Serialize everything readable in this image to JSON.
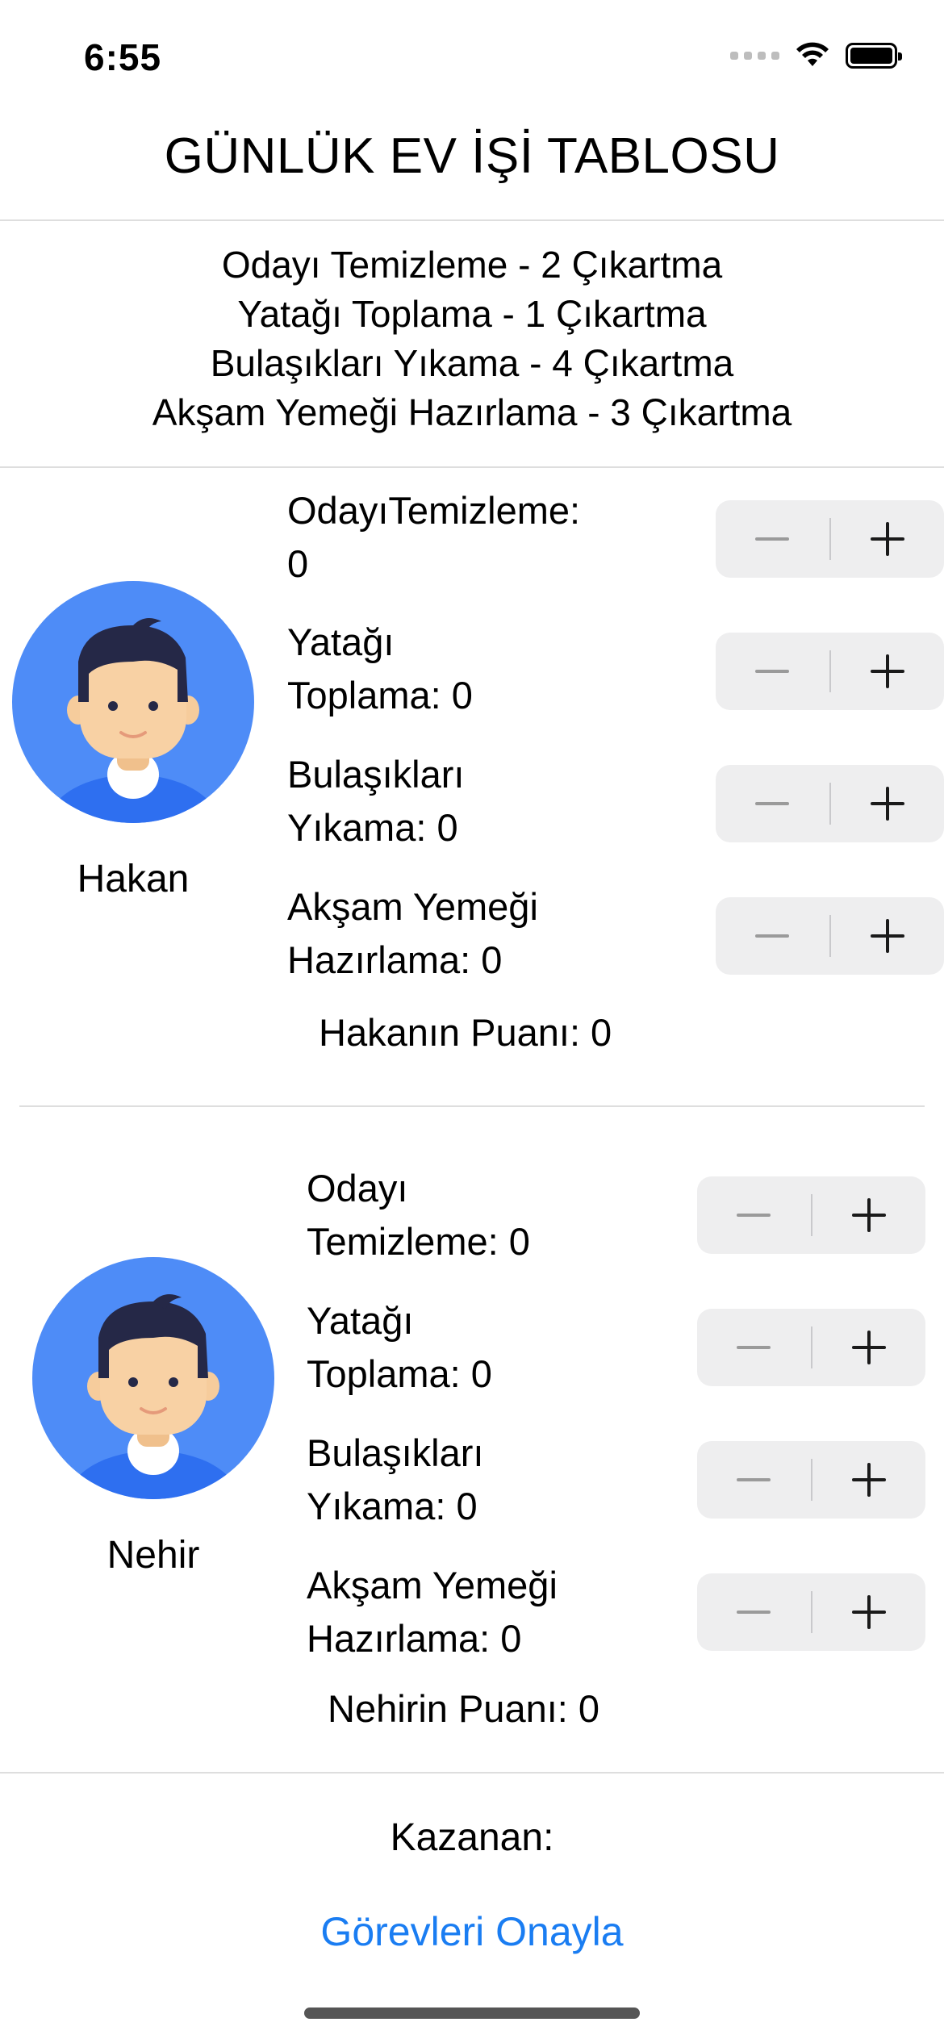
{
  "status_bar": {
    "time": "6:55"
  },
  "title": "GÜNLÜK EV İŞİ TABLOSU",
  "rules": [
    "Odayı Temizleme - 2 Çıkartma",
    "Yatağı Toplama - 1 Çıkartma",
    "Bulaşıkları Yıkama - 4 Çıkartma",
    "Akşam Yemeği Hazırlama - 3 Çıkartma"
  ],
  "players": [
    {
      "name": "Hakan",
      "tasks": [
        {
          "line1": "OdayıTemizleme:",
          "line2": "0"
        },
        {
          "line1": "Yatağı",
          "line2": "Toplama: 0"
        },
        {
          "line1": "Bulaşıkları",
          "line2": "Yıkama: 0"
        },
        {
          "line1": "Akşam Yemeği",
          "line2": "Hazırlama: 0"
        }
      ],
      "score": "Hakanın Puanı: 0"
    },
    {
      "name": "Nehir",
      "tasks": [
        {
          "line1": "Odayı",
          "line2": "Temizleme: 0"
        },
        {
          "line1": "Yatağı",
          "line2": "Toplama: 0"
        },
        {
          "line1": "Bulaşıkları",
          "line2": "Yıkama: 0"
        },
        {
          "line1": "Akşam Yemeği",
          "line2": "Hazırlama: 0"
        }
      ],
      "score": "Nehirin Puanı: 0"
    }
  ],
  "winner_label": "Kazanan:",
  "confirm_button": "Görevleri Onayla",
  "colors": {
    "accent": "#1a7df2",
    "avatar_bg": "#4e8cf7",
    "stepper_bg": "#eeeeef"
  }
}
